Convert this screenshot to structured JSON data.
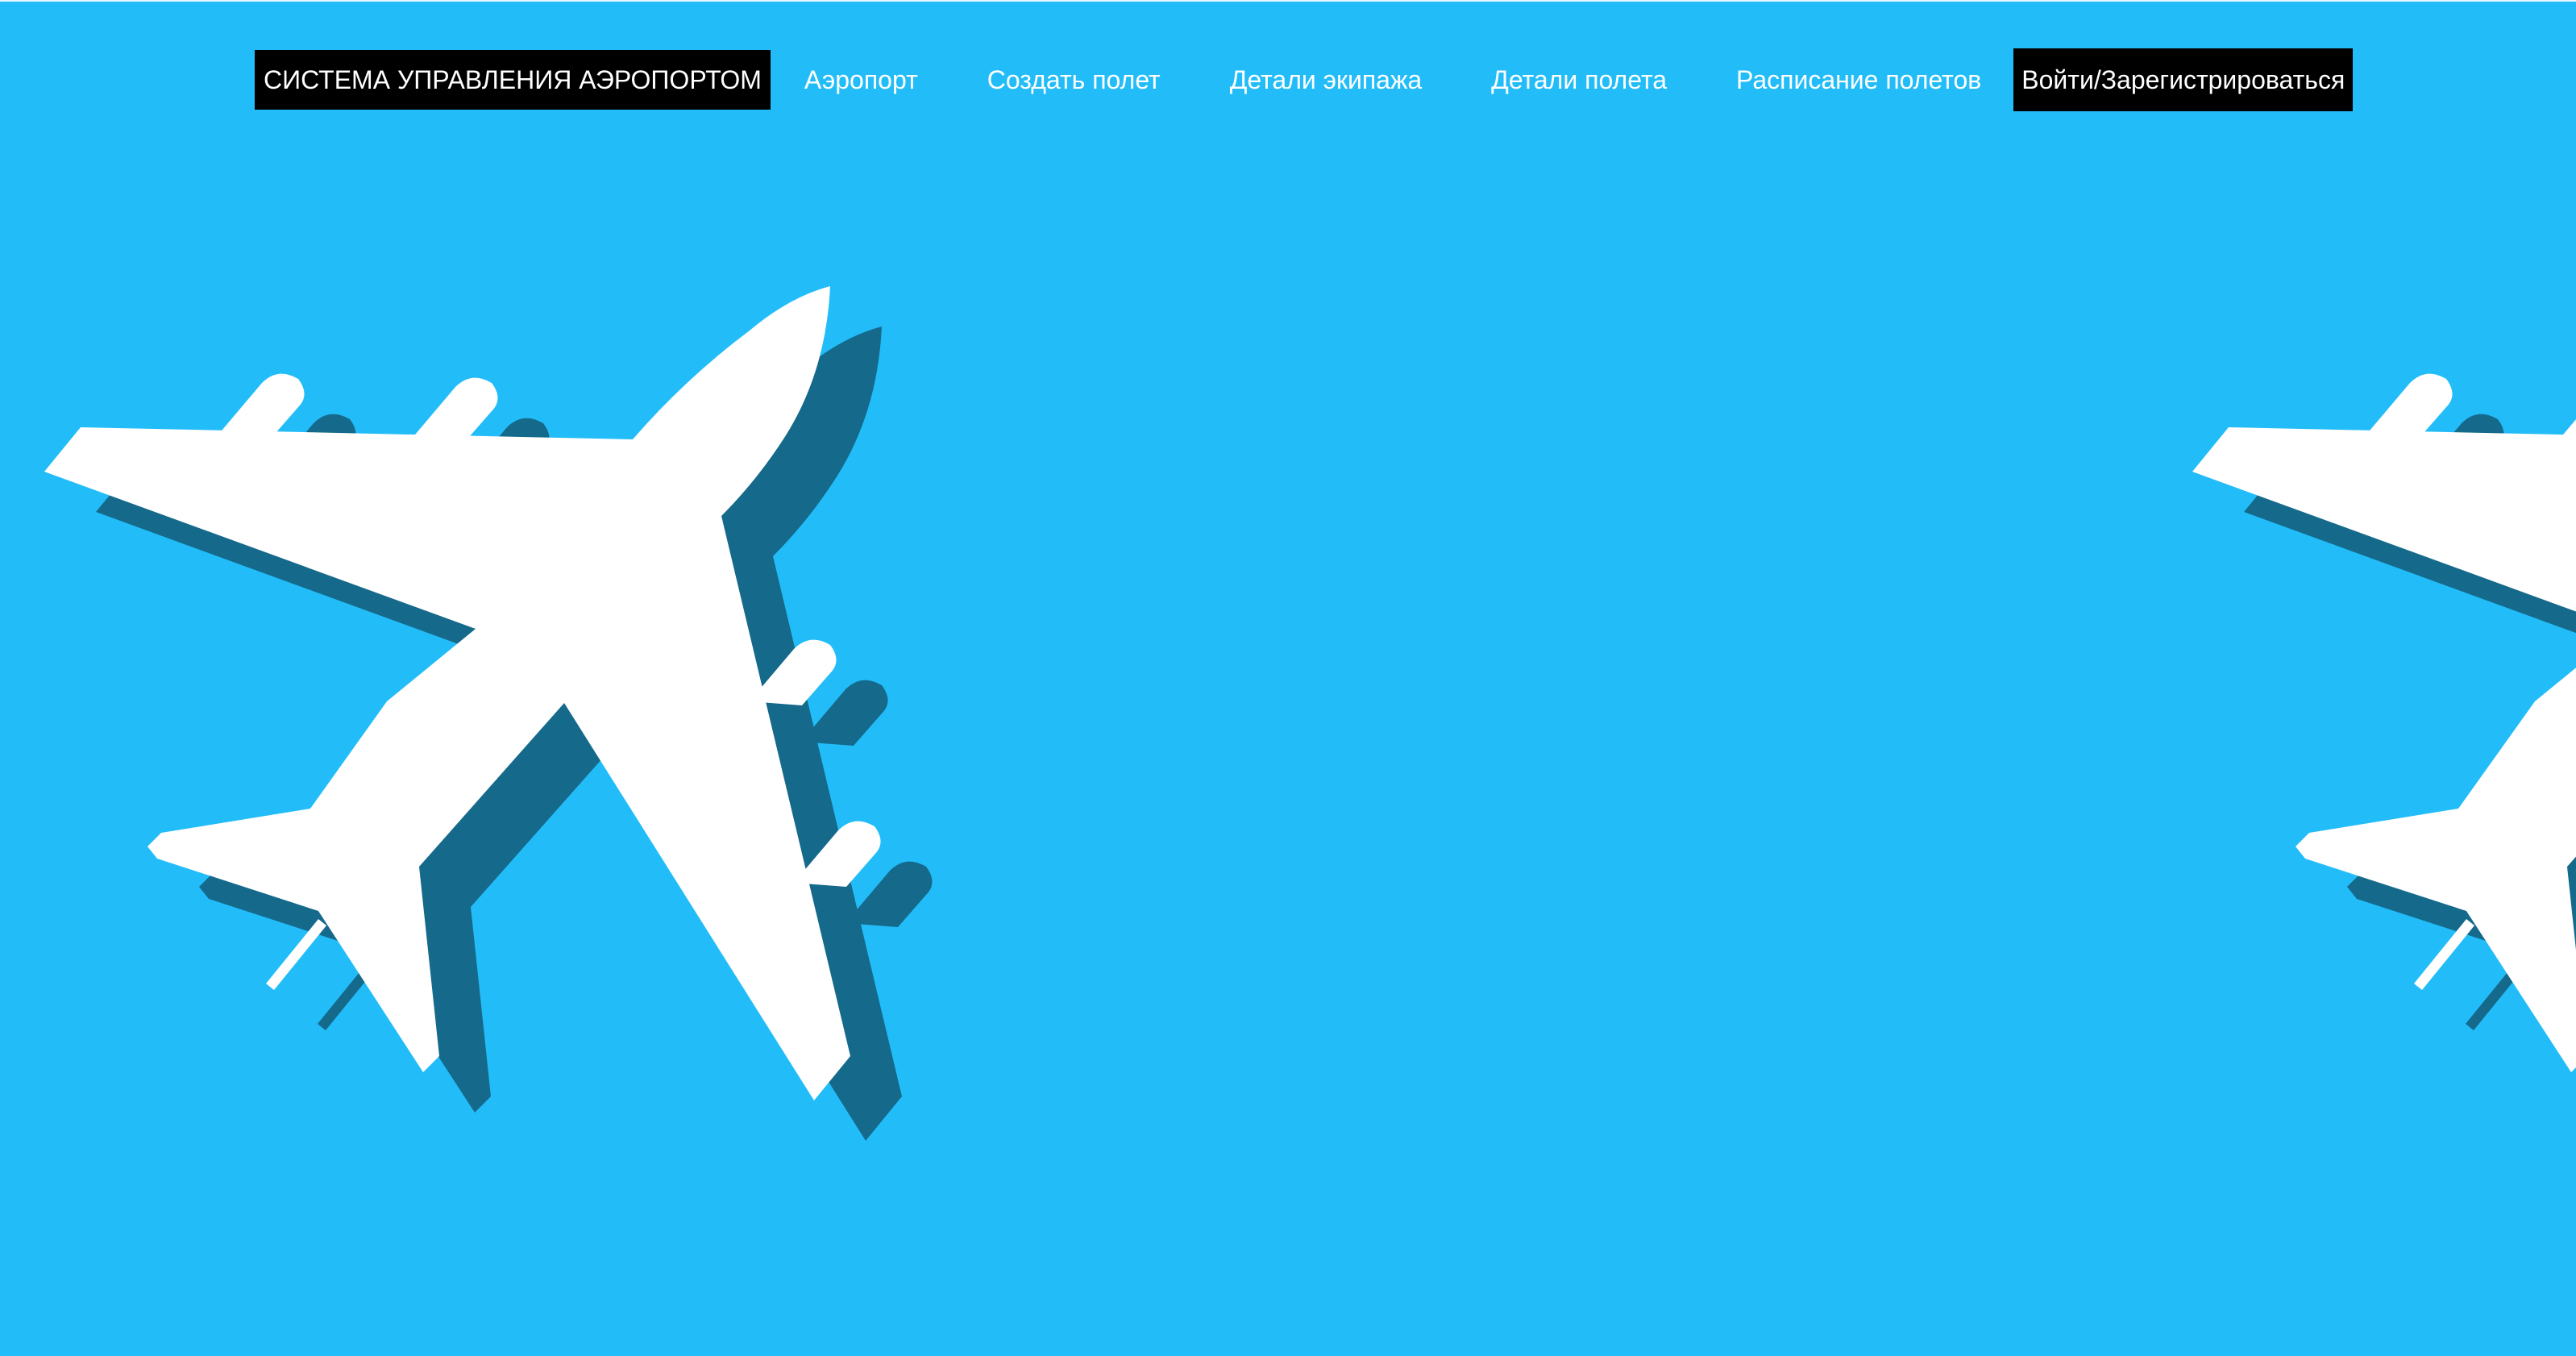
{
  "nav": {
    "brand": "СИСТЕМА УПРАВЛЕНИЯ АЭРОПОРТОМ",
    "links": [
      "Аэропорт",
      "Создать полет",
      "Детали экипажа",
      "Детали полета",
      "Расписание полетов"
    ],
    "login_label": "Войти/Зарегистрироваться"
  },
  "colors": {
    "background": "#22bdf9",
    "plane": "#ffffff",
    "plane_shadow": "#15698b",
    "nav_highlight": "#000000"
  },
  "icons": {
    "hero_left": "airplane-icon",
    "hero_right": "airplane-icon"
  }
}
